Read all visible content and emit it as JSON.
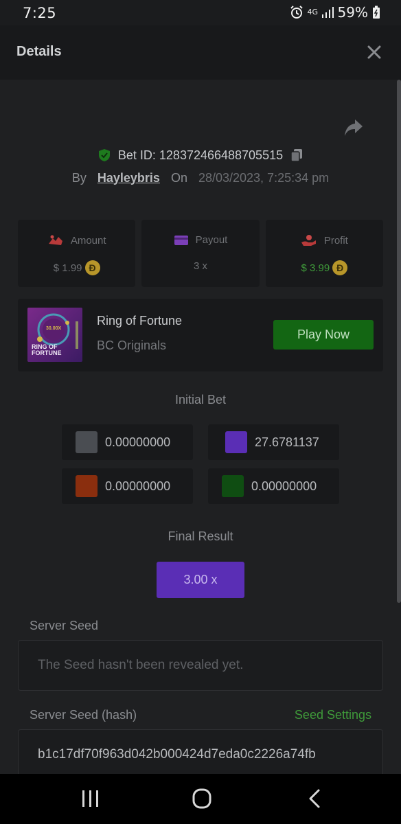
{
  "status_bar": {
    "time": "7:25",
    "network": "4G",
    "battery": "59%"
  },
  "header": {
    "title": "Details"
  },
  "bet": {
    "id_label": "Bet ID: 128372466488705515",
    "by_label": "By",
    "username": "Hayleybris",
    "on_label": "On",
    "date": "28/03/2023, 7:25:34 pm"
  },
  "stats": {
    "amount": {
      "label": "Amount",
      "value": "$ 1.99"
    },
    "payout": {
      "label": "Payout",
      "value": "3 x"
    },
    "profit": {
      "label": "Profit",
      "value": "$ 3.99"
    },
    "coin_symbol": "Ð"
  },
  "game": {
    "name": "Ring of Fortune",
    "provider": "BC Originals",
    "play_label": "Play Now",
    "thumb_title_line1": "RING OF",
    "thumb_title_line2": "FORTUNE",
    "thumb_badge": "30.00X"
  },
  "initial_bet": {
    "label": "Initial Bet",
    "cells": [
      {
        "color": "#4a4d52",
        "value": "0.00000000"
      },
      {
        "color": "#5a2eb5",
        "value": "27.6781137"
      },
      {
        "color": "#8a2e0e",
        "value": "0.00000000"
      },
      {
        "color": "#0f4d12",
        "value": "0.00000000"
      }
    ]
  },
  "final_result": {
    "label": "Final Result",
    "value": "3.00 x"
  },
  "server_seed": {
    "label": "Server Seed",
    "placeholder": "The Seed hasn't been revealed yet."
  },
  "server_seed_hash": {
    "label": "Server Seed (hash)",
    "settings_label": "Seed Settings",
    "value": "b1c17df70f963d042b000424d7eda0c2226a74fb"
  },
  "colors": {
    "accent_green": "#3f9a3a",
    "play_button": "#136613",
    "result_purple": "#5a2eb5"
  },
  "icons": [
    "shield-check-icon",
    "copy-icon",
    "share-icon",
    "close-icon",
    "amount-icon",
    "payout-card-icon",
    "profit-hand-icon",
    "coin-icon",
    "recents-icon",
    "home-icon",
    "back-icon"
  ]
}
